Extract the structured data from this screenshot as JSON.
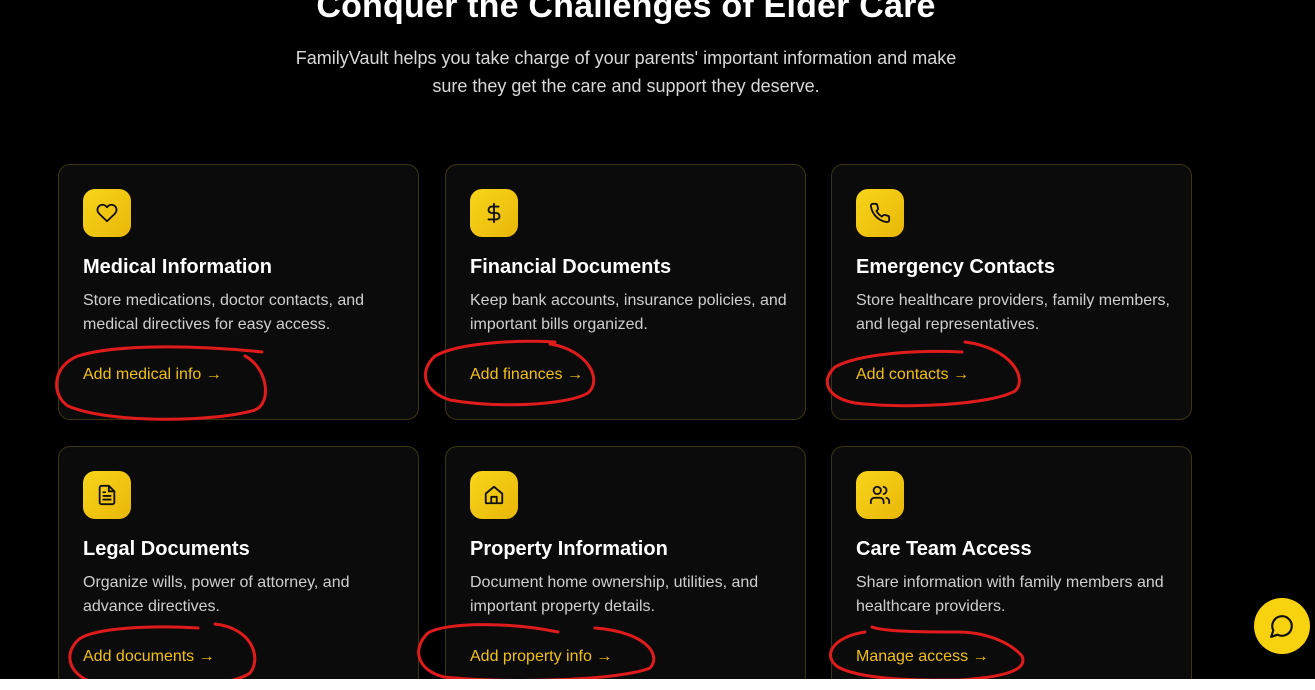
{
  "hero": {
    "title": "Conquer the Challenges of Elder Care",
    "subtitle": "FamilyVault helps you take charge of your parents' important information and make sure they get the care and support they deserve."
  },
  "colors": {
    "background": "#000000",
    "accent": "#f2c014",
    "card_background": "#0b0b0b",
    "card_border": "#3a3514",
    "annotation_red": "#e01b1b"
  },
  "cards": [
    {
      "icon": "heart-icon",
      "title": "Medical Information",
      "description": "Store medications, doctor contacts, and medical directives for easy access.",
      "link": "Add medical info →"
    },
    {
      "icon": "dollar-icon",
      "title": "Financial Documents",
      "description": "Keep bank accounts, insurance policies, and important bills organized.",
      "link": "Add finances →"
    },
    {
      "icon": "phone-icon",
      "title": "Emergency Contacts",
      "description": "Store healthcare providers, family members, and legal representatives.",
      "link": "Add contacts →"
    },
    {
      "icon": "document-icon",
      "title": "Legal Documents",
      "description": "Organize wills, power of attorney, and advance directives.",
      "link": "Add documents →"
    },
    {
      "icon": "home-icon",
      "title": "Property Information",
      "description": "Document home ownership, utilities, and important property details.",
      "link": "Add property info →"
    },
    {
      "icon": "users-icon",
      "title": "Care Team Access",
      "description": "Share information with family members and healthcare providers.",
      "link": "Manage access →"
    }
  ],
  "chat": {
    "icon": "chat-bubble-icon"
  }
}
